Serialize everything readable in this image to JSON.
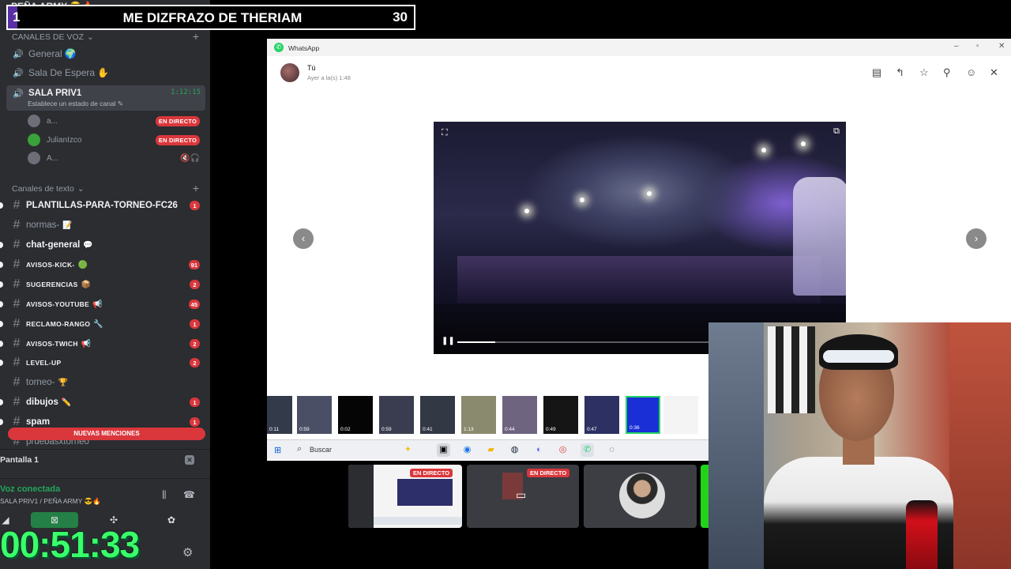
{
  "overlay": {
    "left_number": "1",
    "title": "ME DIZFRAZO DE THERIAM",
    "right_number": "30"
  },
  "discord": {
    "server_name": "PEÑA ARMY 😎🔥",
    "voice_section": "CANALES DE VOZ",
    "voice_channels": [
      {
        "name": "General",
        "emoji": "🌍"
      },
      {
        "name": "Sala De Espera",
        "emoji": "✋"
      }
    ],
    "active_channel": {
      "name": "SALA PRIV1",
      "status": "Establece un estado de canal",
      "elapsed": "1:12:15"
    },
    "voice_users": [
      {
        "name": "a...",
        "badge": "EN DIRECTO"
      },
      {
        "name": "JulianIzco",
        "badge": "EN DIRECTO"
      },
      {
        "name": "A...",
        "badge": ""
      }
    ],
    "text_section": "Canales de texto",
    "text_channels": [
      {
        "name": "PLANTILLAS-PARA-TORNEO-FC26",
        "emoji": "",
        "count": "1",
        "unread": true
      },
      {
        "name": "normas-",
        "emoji": "📝",
        "count": "",
        "unread": false
      },
      {
        "name": "chat-general",
        "emoji": "💬",
        "count": "",
        "unread": true
      },
      {
        "name": "avisos-kick-",
        "emoji": "🟢",
        "count": "91",
        "unread": true
      },
      {
        "name": "sugerencias",
        "emoji": "📦",
        "count": "2",
        "unread": true
      },
      {
        "name": "avisos-youtube",
        "emoji": "📢",
        "count": "45",
        "unread": true
      },
      {
        "name": "reclamo-rango",
        "emoji": "🔧",
        "count": "1",
        "unread": true
      },
      {
        "name": "avisos-twich",
        "emoji": "📢",
        "count": "2",
        "unread": true
      },
      {
        "name": "level-up",
        "emoji": "",
        "count": "2",
        "unread": true
      },
      {
        "name": "torneo-",
        "emoji": "🏆",
        "count": "",
        "unread": false
      },
      {
        "name": "dibujos",
        "emoji": "✏️",
        "count": "1",
        "unread": true
      },
      {
        "name": "spam",
        "emoji": "",
        "count": "1",
        "unread": true
      },
      {
        "name": "pruebasxtorneo",
        "emoji": "",
        "count": "",
        "unread": false
      }
    ],
    "mentions_bar": "NUEVAS MENCIONES",
    "screen_label": "Pantalla 1",
    "voice_connected": "Voz conectada",
    "voice_location": "SALA PRIV1 / PEÑA ARMY 😎🔥",
    "big_timer": "00:51:33"
  },
  "whatsapp": {
    "app_title": "WhatsApp",
    "sender": "Tú",
    "time": "Ayer a la(s) 1:48",
    "video_progress": 0.1,
    "thumb_durations": [
      "0:11",
      "0:59",
      "0:02",
      "0:59",
      "0:41",
      "1:13",
      "0:44",
      "0:49",
      "0:47",
      "0:36",
      ""
    ],
    "selected_thumb": 9
  },
  "taskbar": {
    "search_label": "Buscar"
  },
  "previews": {
    "live1": "EN DIRECTO",
    "live2": "EN DIRECTO"
  },
  "colors": {
    "discord_bg": "#2b2d31",
    "live_red": "#da373c",
    "timer_green": "#39ff6a",
    "whatsapp_green": "#25d366"
  }
}
